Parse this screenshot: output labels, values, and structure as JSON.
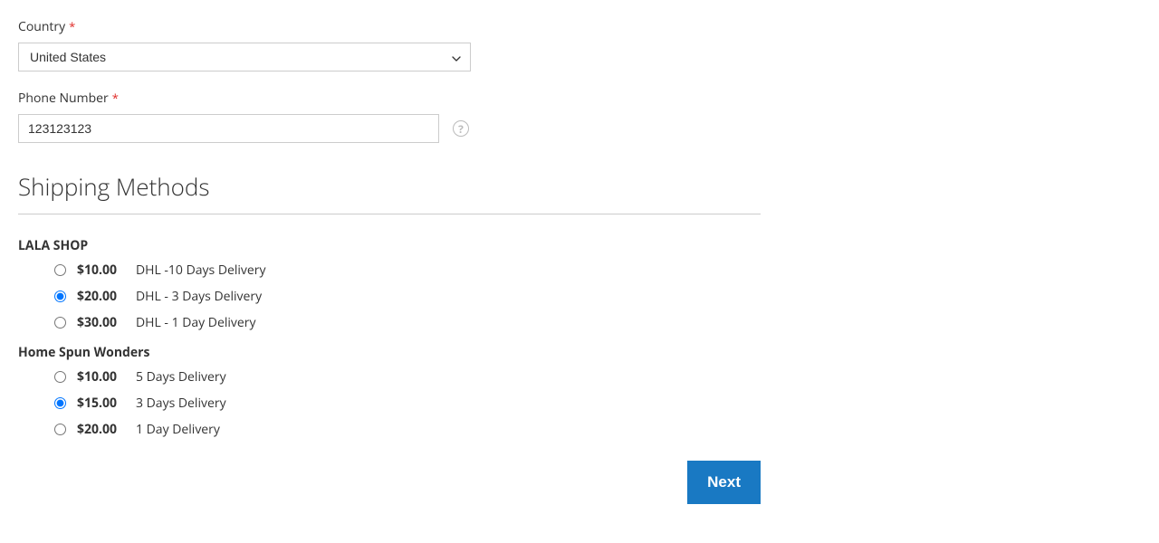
{
  "fields": {
    "country": {
      "label": "Country",
      "value": "United States"
    },
    "phone": {
      "label": "Phone Number",
      "value": "123123123"
    }
  },
  "shipping": {
    "title": "Shipping Methods",
    "vendors": [
      {
        "name": "LALA SHOP",
        "options": [
          {
            "price": "$10.00",
            "label": "DHL -10 Days Delivery",
            "selected": false
          },
          {
            "price": "$20.00",
            "label": "DHL - 3 Days Delivery",
            "selected": true
          },
          {
            "price": "$30.00",
            "label": "DHL - 1 Day Delivery",
            "selected": false
          }
        ]
      },
      {
        "name": "Home Spun Wonders",
        "options": [
          {
            "price": "$10.00",
            "label": "5 Days Delivery",
            "selected": false
          },
          {
            "price": "$15.00",
            "label": "3 Days Delivery",
            "selected": true
          },
          {
            "price": "$20.00",
            "label": "1 Day Delivery",
            "selected": false
          }
        ]
      }
    ]
  },
  "actions": {
    "next": "Next"
  }
}
